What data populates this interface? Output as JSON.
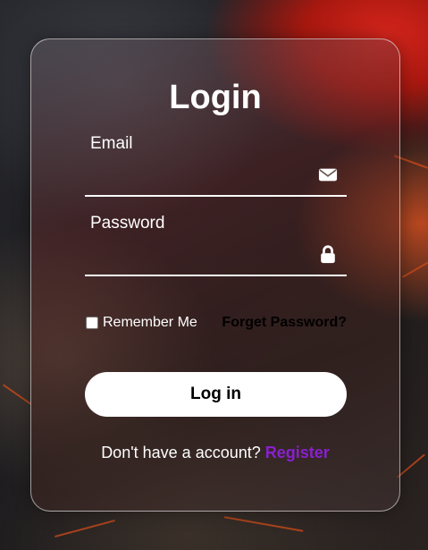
{
  "form": {
    "title": "Login",
    "email_label": "Email",
    "email_value": "",
    "email_icon": "envelope-icon",
    "password_label": "Password",
    "password_value": "",
    "password_icon": "lock-icon",
    "remember_label": "Remember Me",
    "remember_checked": false,
    "forgot_label": "Forget Password?",
    "submit_label": "Log in",
    "register_prompt": "Don't have a account?",
    "register_link": "Register"
  },
  "colors": {
    "accent": "#8a1fd0",
    "button_bg": "#ffffff",
    "text": "#ffffff"
  }
}
